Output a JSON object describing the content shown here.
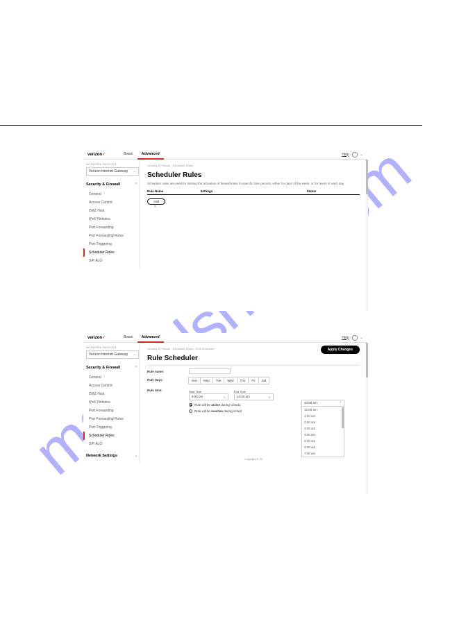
{
  "watermark": "manualshive.com",
  "header": {
    "logo": "verizon",
    "logo_check": "✓",
    "tab_basic": "Basic",
    "tab_advanced": "Advanced",
    "right_link": "Help"
  },
  "sidebar": {
    "device_label": "NETWORK DEVICES",
    "device_value": "Verizon Internet Gateway",
    "section": "Security & Firewall",
    "items": [
      "General",
      "Access Control",
      "DMZ Host",
      "IPv6 Pinholes",
      "Port Forwarding",
      "Port Forwarding Rules",
      "Port Triggering",
      "Scheduler Rules",
      "SIP ALG"
    ],
    "section2": "Network Settings"
  },
  "panel1": {
    "breadcrumb": "Security & Firewall  ›  Scheduler Rules",
    "title": "Scheduler Rules",
    "desc": "Scheduler rules are used for limiting the activation of firewall rules to specific time periods, either for days of the week, or for hours of each day.",
    "th1": "Rule Name",
    "th2": "Settings",
    "th3": "Status",
    "add": "Add",
    "cursor": "↖"
  },
  "panel2": {
    "breadcrumb": "Security & Firewall  ›  Scheduler Rules  ›  Rule Scheduler",
    "title": "Rule Scheduler",
    "apply": "Apply Changes",
    "rule_name_label": "Rule name:",
    "rule_days_label": "Rule days:",
    "days": [
      "Sun",
      "Mon",
      "Tue",
      "Wed",
      "Thu",
      "Fri",
      "Sat"
    ],
    "rule_time_label": "Rule time:",
    "start_label": "Start Time",
    "end_label": "End Time",
    "start_val": "9:00 pm",
    "end_val": "12:00 am",
    "radio_active": "Rule will be active during scheduled time",
    "radio_inactive": "Rule will be inactive during scheduled time",
    "radio_bold_active": "active",
    "radio_bold_inactive": "inactive",
    "dropdown": [
      "12:00 am",
      "1:00 am",
      "2:00 am",
      "3:00 am",
      "4:00 am",
      "5:00 am",
      "6:00 am",
      "7:00 am"
    ],
    "footer": "Copyright © 20"
  }
}
